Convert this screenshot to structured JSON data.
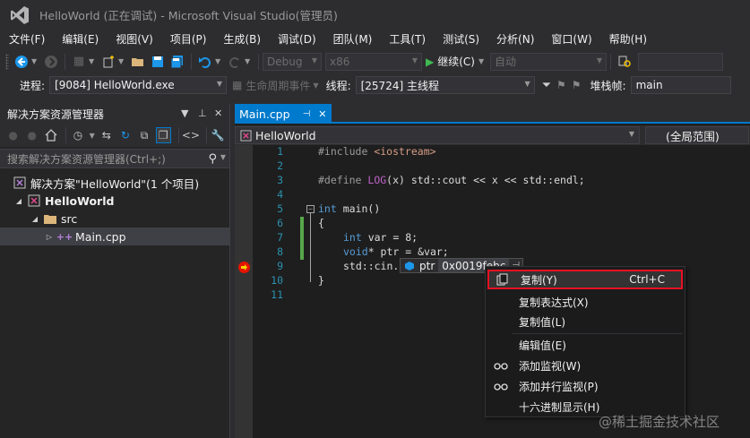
{
  "window": {
    "title": "HelloWorld (正在调试) - Microsoft Visual Studio(管理员)"
  },
  "menu": [
    "文件(F)",
    "编辑(E)",
    "视图(V)",
    "项目(P)",
    "生成(B)",
    "调试(D)",
    "团队(M)",
    "工具(T)",
    "测试(S)",
    "分析(N)",
    "窗口(W)",
    "帮助(H)"
  ],
  "toolbar": {
    "config": "Debug",
    "platform": "x86",
    "continue_label": "继续(C)",
    "auto": "自动"
  },
  "debug_bar": {
    "process_label": "进程:",
    "process_value": "[9084] HelloWorld.exe",
    "lifecycle": "生命周期事件",
    "thread_label": "线程:",
    "thread_value": "[25724] 主线程",
    "stack_label": "堆栈帧:",
    "stack_value": "main"
  },
  "solution_explorer": {
    "title": "解决方案资源管理器",
    "search_placeholder": "搜索解决方案资源管理器(Ctrl+;)",
    "tree": [
      {
        "label": "解决方案\"HelloWorld\"(1 个项目)"
      },
      {
        "label": "HelloWorld"
      },
      {
        "label": "src"
      },
      {
        "label": "Main.cpp"
      }
    ]
  },
  "editor": {
    "tab_label": "Main.cpp",
    "scope_combo": "HelloWorld",
    "member_combo": "(全局范围)",
    "lines": [
      {
        "num": "1",
        "text": "#include <iostream>"
      },
      {
        "num": "2",
        "text": ""
      },
      {
        "num": "3",
        "text": "#define LOG(x) std::cout << x << std::endl;"
      },
      {
        "num": "4",
        "text": ""
      },
      {
        "num": "5",
        "text": "int main()"
      },
      {
        "num": "6",
        "text": "{"
      },
      {
        "num": "7",
        "text": "int var = 8;"
      },
      {
        "num": "8",
        "text": "void* ptr = &var;"
      },
      {
        "num": "9",
        "text": "std::cin."
      },
      {
        "num": "10",
        "text": "}"
      },
      {
        "num": "11",
        "text": ""
      }
    ],
    "code_parts": {
      "l1a": "#include ",
      "l1b": "<iostream>",
      "l3a": "#define ",
      "l3b": "LOG",
      "l3c": "(x) std::cout << x << std::endl;",
      "l5a": "int",
      "l5b": " main()",
      "l7a": "int",
      "l7b": " var = 8;",
      "l8a": "void",
      "l8b": "* ptr = &var;",
      "l9": "std::cin.",
      "l10": "}",
      "l6": "{"
    },
    "datatip": {
      "name": "ptr",
      "value": "0x0019febc"
    }
  },
  "context_menu": [
    {
      "label": "复制(Y)",
      "shortcut": "Ctrl+C"
    },
    {
      "label": "复制表达式(X)",
      "shortcut": ""
    },
    {
      "label": "复制值(L)",
      "shortcut": ""
    },
    {
      "label": "编辑值(E)",
      "shortcut": ""
    },
    {
      "label": "添加监视(W)",
      "shortcut": ""
    },
    {
      "label": "添加并行监视(P)",
      "shortcut": ""
    },
    {
      "label": "十六进制显示(H)",
      "shortcut": ""
    }
  ],
  "watermark": "@稀土掘金技术社区",
  "colors": {
    "accent": "#007acc",
    "highlight_border": "#e81123",
    "breakpoint": "#e51400",
    "keyword": "#569cd6",
    "line_number": "#2b91af"
  }
}
